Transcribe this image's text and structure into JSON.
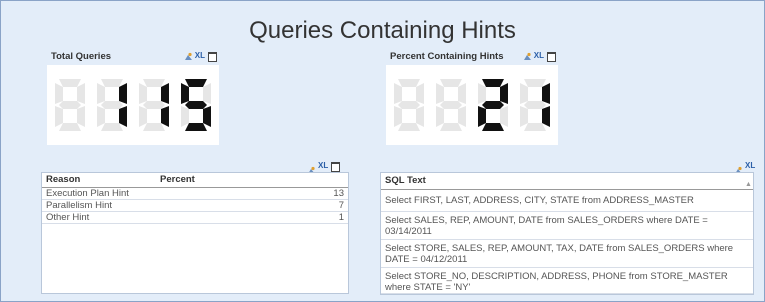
{
  "sheet": {
    "title": "Queries Containing Hints"
  },
  "total_queries": {
    "caption": "Total Queries",
    "value": "115"
  },
  "percent_hints": {
    "caption": "Percent Containing Hints",
    "value": "21"
  },
  "reason_table": {
    "headers": [
      "Reason",
      "Percent"
    ],
    "rows": [
      {
        "reason": "Execution Plan Hint",
        "percent": "13"
      },
      {
        "reason": "Parallelism Hint",
        "percent": "7"
      },
      {
        "reason": "Other Hint",
        "percent": "1"
      }
    ]
  },
  "sql_table": {
    "header": "SQL Text",
    "rows": [
      "Select FIRST, LAST, ADDRESS, CITY, STATE from ADDRESS_MASTER",
      "Select SALES, REP, AMOUNT, DATE from SALES_ORDERS where DATE = 03/14/2011",
      "Select STORE, SALES, REP, AMOUNT, TAX,  DATE from SALES_ORDERS where DATE = 04/12/2011",
      "Select STORE_NO, DESCRIPTION, ADDRESS, PHONE from STORE_MASTER where STATE = 'NY'"
    ]
  },
  "colors": {
    "background": "#e3edf9",
    "led_on": "#111111",
    "led_off": "#e6e6e6",
    "accent": "#2b5fa8"
  },
  "icons": [
    "export-icon",
    "xl-icon",
    "minimize-icon"
  ]
}
